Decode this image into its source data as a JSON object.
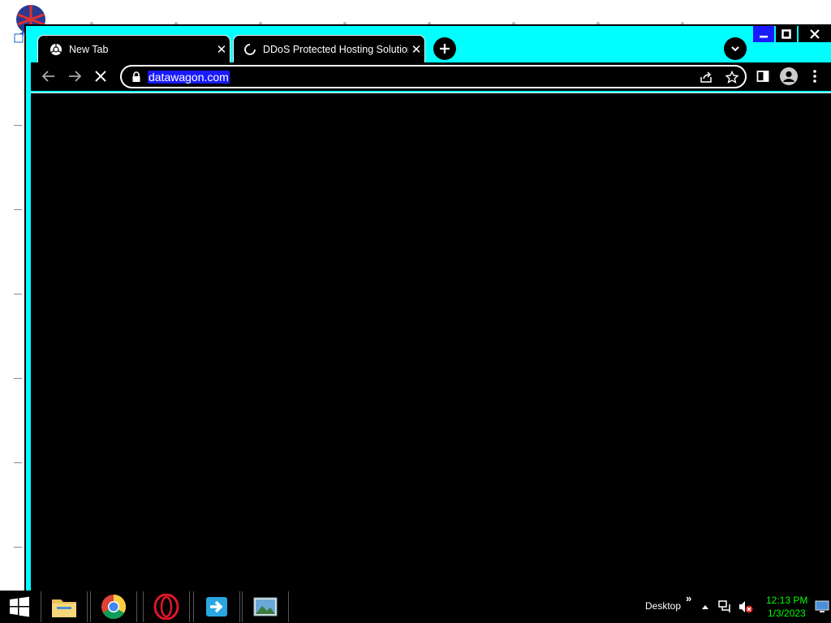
{
  "browser": {
    "tabs": [
      {
        "title": "New Tab",
        "icon": "chrome-icon",
        "active": false
      },
      {
        "title": "DDoS Protected Hosting Solutions",
        "icon": "loading-spinner-icon",
        "active": true
      }
    ],
    "omnibox": {
      "url": "datawagon.com"
    }
  },
  "taskbar": {
    "pinned": [
      "file-explorer-icon",
      "chrome-icon",
      "opera-icon",
      "remote-app-icon",
      "photos-icon"
    ],
    "desktop_label": "Desktop",
    "chevron": "»",
    "time": "12:13 PM",
    "date": "1/3/2023"
  },
  "colors": {
    "window_frame": "#00ffff",
    "page_background": "#000000",
    "selection": "#1a1aff",
    "clock": "#00ff00"
  }
}
